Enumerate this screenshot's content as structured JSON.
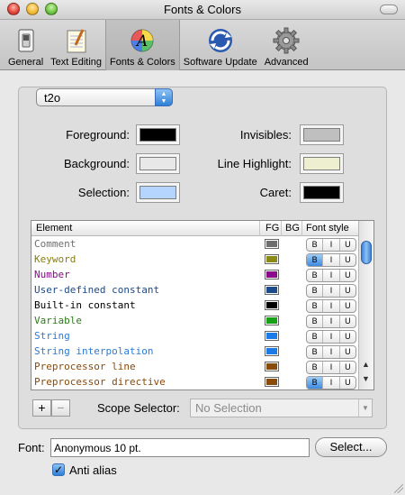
{
  "window": {
    "title": "Fonts & Colors"
  },
  "toolbar": {
    "items": [
      {
        "label": "General",
        "icon": "switch-icon"
      },
      {
        "label": "Text Editing",
        "icon": "notepad-icon"
      },
      {
        "label": "Fonts & Colors",
        "icon": "color-a-icon",
        "selected": true
      },
      {
        "label": "Software Update",
        "icon": "sync-arrows-icon"
      },
      {
        "label": "Advanced",
        "icon": "gear-icon"
      }
    ]
  },
  "theme": {
    "selected": "t2o"
  },
  "colors": {
    "foreground": {
      "label": "Foreground:",
      "color": "#000000"
    },
    "background": {
      "label": "Background:",
      "color": "#e8e8e8"
    },
    "selection": {
      "label": "Selection:",
      "color": "#b5d5ff"
    },
    "invisibles": {
      "label": "Invisibles:",
      "color": "#bfbfbf"
    },
    "line_highlight": {
      "label": "Line Highlight:",
      "color": "#eeefd0"
    },
    "caret": {
      "label": "Caret:",
      "color": "#000000"
    }
  },
  "table": {
    "headers": {
      "element": "Element",
      "fg": "FG",
      "bg": "BG",
      "font_style": "Font style"
    },
    "style_letters": [
      "B",
      "I",
      "U"
    ],
    "rows": [
      {
        "name": "Comment",
        "color": "#6e6e6e",
        "fg": "#6e6e6e",
        "bold": false
      },
      {
        "name": "Keyword",
        "color": "#8a7d0a",
        "fg": "#8a8a14",
        "bold": true
      },
      {
        "name": "Number",
        "color": "#8a0a8a",
        "fg": "#8a0a8a",
        "bold": false
      },
      {
        "name": "User-defined constant",
        "color": "#1c4a8a",
        "fg": "#1c4a8a",
        "bold": false
      },
      {
        "name": "Built-in constant",
        "color": "#000000",
        "fg": "#000000",
        "bold": false
      },
      {
        "name": "Variable",
        "color": "#2a7d1a",
        "fg": "#18a018",
        "bold": false
      },
      {
        "name": "String",
        "color": "#2a7bd8",
        "fg": "#1a7ae8",
        "bold": false
      },
      {
        "name": "String interpolation",
        "color": "#2a7bd8",
        "fg": "#1a7ae8",
        "bold": false
      },
      {
        "name": "Preprocessor line",
        "color": "#8a4a0a",
        "fg": "#8a4a0a",
        "bold": false
      },
      {
        "name": "Preprocessor directive",
        "color": "#8a4a0a",
        "fg": "#8a4a0a",
        "bold": true
      }
    ]
  },
  "controls": {
    "add": "+",
    "remove": "−"
  },
  "scope": {
    "label": "Scope Selector:",
    "value": "No Selection"
  },
  "font": {
    "label": "Font:",
    "value": "Anonymous 10 pt.",
    "select_button": "Select..."
  },
  "anti_alias": {
    "label": "Anti alias",
    "checked": true
  }
}
